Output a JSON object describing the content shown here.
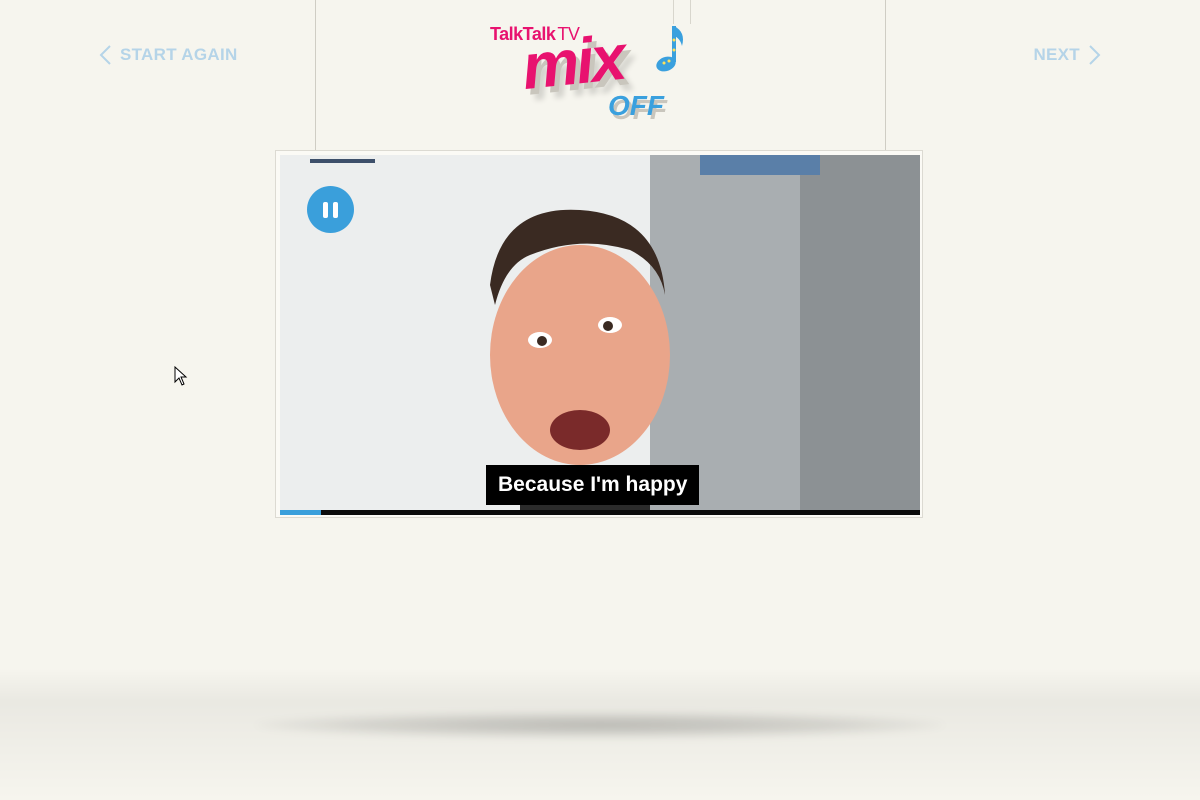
{
  "nav": {
    "start_again_label": "START AGAIN",
    "next_label": "NEXT"
  },
  "logo": {
    "brand": "TalkTalk",
    "brand_suffix": "TV",
    "title": "mix",
    "subtitle": "OFF"
  },
  "video": {
    "caption": "Because I'm happy",
    "progress": 0.064,
    "state": "playing"
  },
  "colors": {
    "background": "#f6f5ee",
    "accent": "#3a9fdb",
    "nav_text": "#b5d4e8",
    "brand_pink": "#e8126f"
  },
  "icons": {
    "start_again": "chevron-left-icon",
    "next": "chevron-right-icon",
    "pause": "pause-icon",
    "note": "music-note-icon",
    "cursor": "mouse-pointer-icon"
  }
}
